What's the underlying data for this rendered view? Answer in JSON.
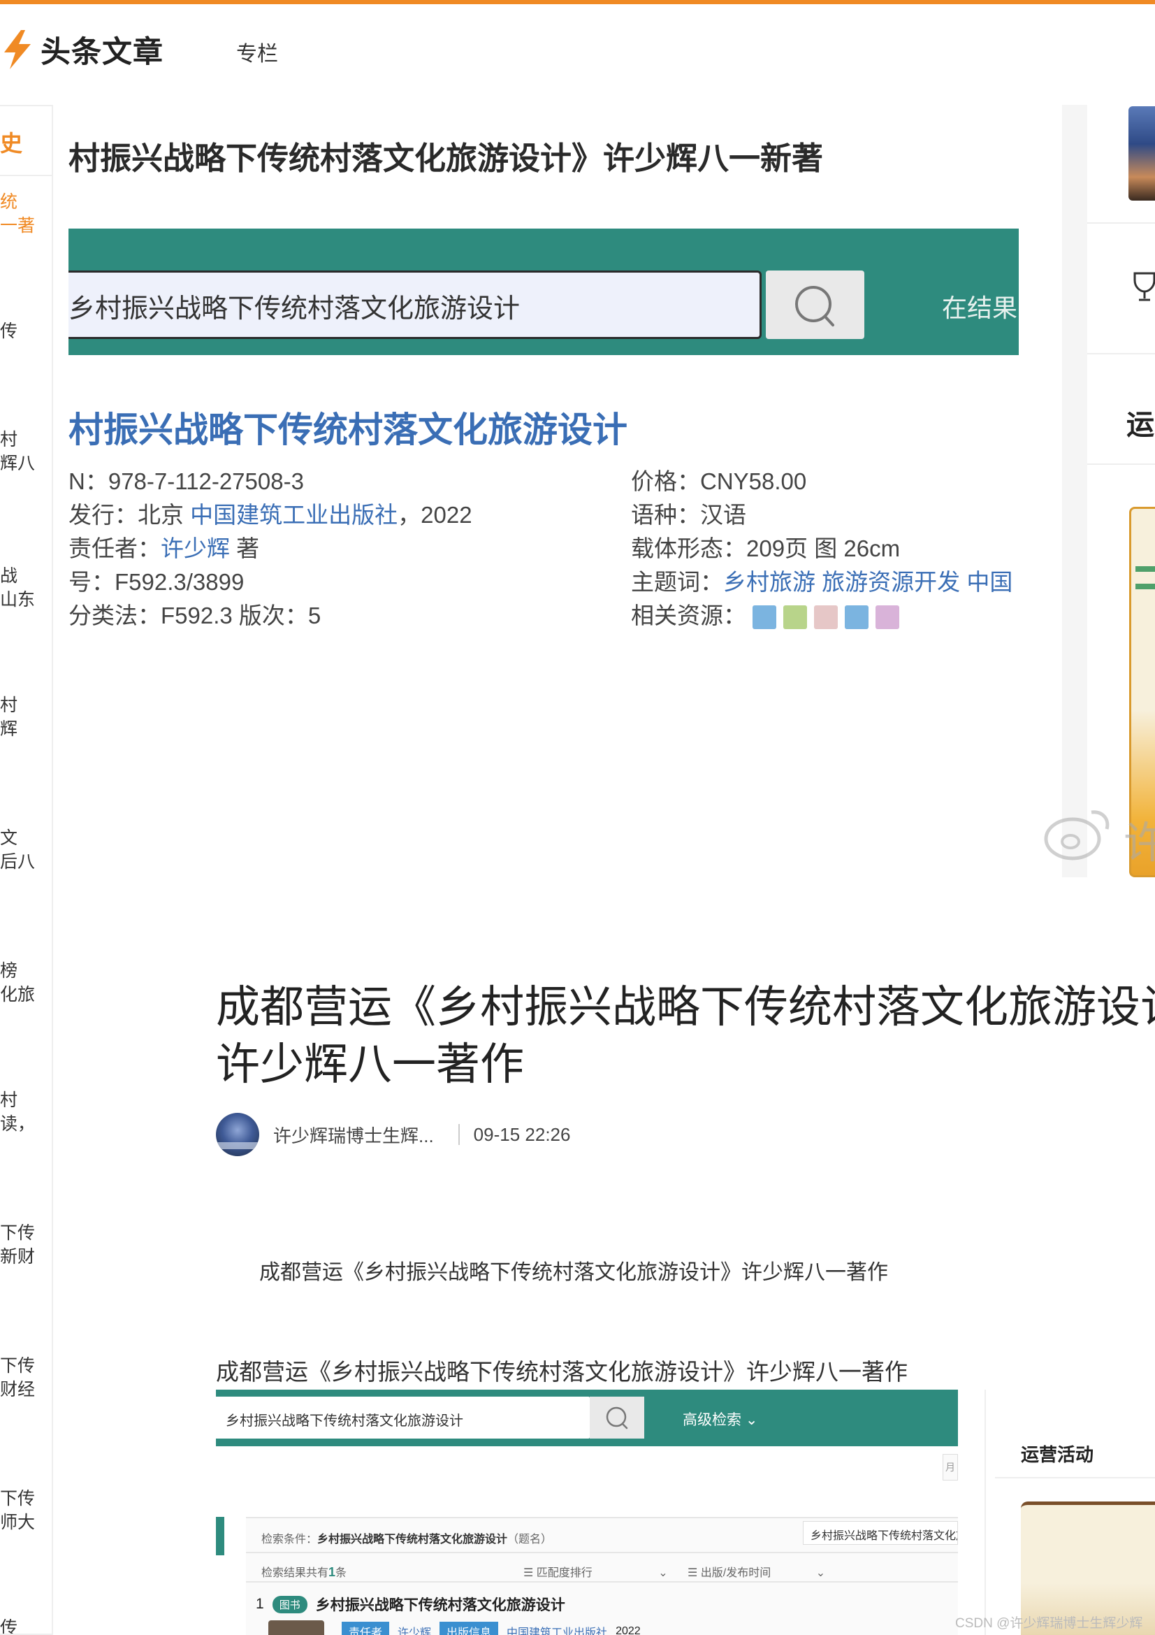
{
  "header": {
    "logo_text": "头条文章",
    "nav_zhuanlan": "专栏"
  },
  "sidebar": {
    "head": "史",
    "items": [
      {
        "text": "统\n一著"
      },
      {
        "text": "传"
      },
      {
        "text": "村\n辉八"
      },
      {
        "text": "战\n山东"
      },
      {
        "text": "村\n辉"
      },
      {
        "text": "文\n后八"
      },
      {
        "text": "榜\n化旅"
      },
      {
        "text": "村\n读，"
      },
      {
        "text": "下传\n新财"
      },
      {
        "text": "下传\n财经"
      },
      {
        "text": "下传\n师大"
      },
      {
        "text": "传"
      }
    ]
  },
  "image1": {
    "title": "村振兴战略下传统村落文化旅游设计》许少辉八一新著",
    "search_text": "乡村振兴战略下传统村落文化旅游设计",
    "band_right": "在结果",
    "book_title": "村振兴战略下传统村落文化旅游设计",
    "left_meta": [
      {
        "label": "N：",
        "value": "978-7-112-27508-3",
        "link": ""
      },
      {
        "label": "发行：北京 ",
        "value": "，2022",
        "link": "中国建筑工业出版社"
      },
      {
        "label": "责任者：",
        "value": " 著",
        "link": "许少辉"
      },
      {
        "label": "号：",
        "value": "F592.3/3899",
        "link": ""
      },
      {
        "label": "分类法：",
        "value": "F592.3 版次：5",
        "link": ""
      }
    ],
    "right_meta": [
      {
        "label": "价格：",
        "value": "CNY58.00",
        "link": ""
      },
      {
        "label": "语种：",
        "value": "汉语",
        "link": ""
      },
      {
        "label": "载体形态：",
        "value": "209页 图 26cm",
        "link": ""
      },
      {
        "label": "主题词：",
        "value": "",
        "link": "乡村旅游 旅游资源开发 中国"
      },
      {
        "label": "相关资源：",
        "value": "",
        "link": ""
      }
    ]
  },
  "right_column": {
    "yun_char": "运",
    "weibo_char": "许"
  },
  "article": {
    "title_line1": "成都营运《乡村振兴战略下传统村落文化旅游设计》",
    "title_line2": "许少辉八一著作",
    "author": "许少辉瑞博士生辉...",
    "time": "09-15 22:26",
    "para1": "成都营运《乡村振兴战略下传统村落文化旅游设计》许少辉八一著作",
    "para2": "成都营运《乡村振兴战略下传统村落文化旅游设计》许少辉八一著作"
  },
  "image2": {
    "search_text": "乡村振兴战略下传统村落文化旅游设计",
    "advanced": "高级检索",
    "right_title": "运营活动",
    "small_box": "月",
    "cond_label": "检索条件：",
    "cond_value": "乡村振兴战略下传统村落文化旅游设计",
    "cond_suffix": "（题名）",
    "cond_box": "乡村振兴战略下传统村落文化旅游设计",
    "count_prefix": "检索结果共有",
    "count_num": "1",
    "count_suffix": "条",
    "sort1": "匹配度排行",
    "sort2": "出版/发布时间",
    "item_index": "1",
    "item_tag": "图书",
    "item_title": "乡村振兴战略下传统村落文化旅游设计",
    "sub_tag1": "责任者",
    "sub_link1": "许少辉",
    "sub_tag2": "出版信息",
    "sub_link2": "中国建筑工业出版社",
    "sub_year": "2022"
  },
  "watermark": "CSDN @许少辉瑞博士生辉少辉",
  "colors": {
    "accent": "#f08a24",
    "teal": "#2e8b7e",
    "link": "#3a6eb5"
  }
}
